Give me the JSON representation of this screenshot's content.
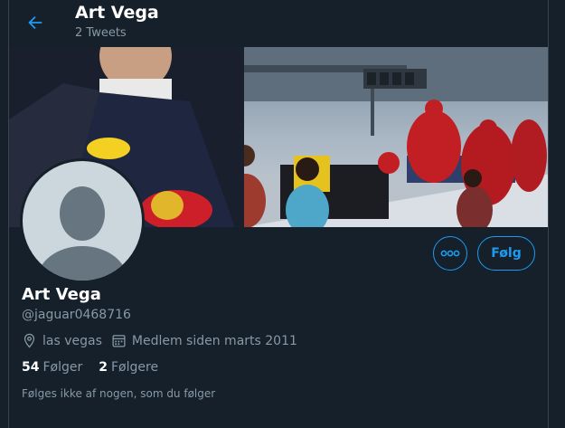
{
  "header": {
    "name": "Art Vega",
    "tweet_count": "2 Tweets",
    "back_icon": "arrow-left-icon"
  },
  "profile": {
    "name": "Art Vega",
    "handle": "@jaguar0468716",
    "location": "las vegas",
    "joined": "Medlem siden marts 2011",
    "following_count": "54",
    "following_label": "Følger",
    "followers_count": "2",
    "followers_label": "Følgere",
    "mutual_note": "Følges ikke af nogen, som du følger"
  },
  "actions": {
    "follow_label": "Følg",
    "more_icon": "more-dots-icon"
  },
  "colors": {
    "background": "#15202b",
    "accent": "#1d9bf0",
    "secondary_text": "#8899a6",
    "border": "#38444d"
  }
}
